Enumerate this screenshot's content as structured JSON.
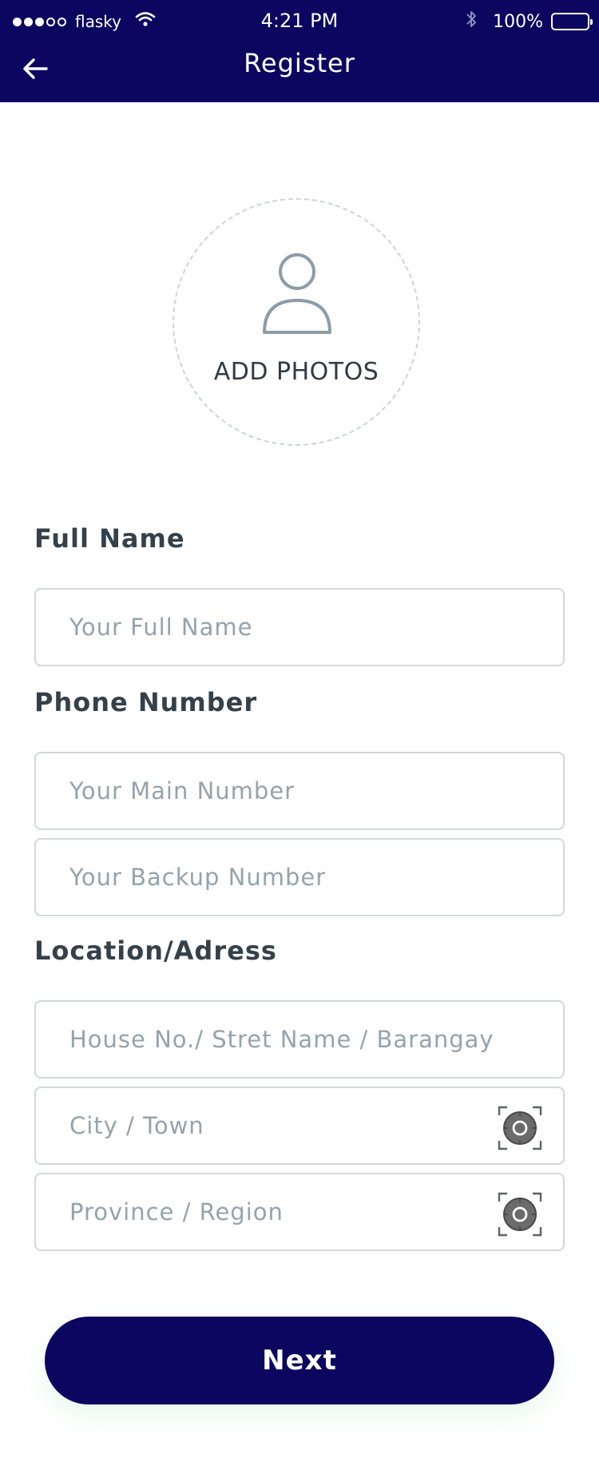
{
  "status_bar": {
    "carrier": "flasky",
    "time": "4:21 PM",
    "battery": "100%"
  },
  "nav": {
    "title": "Register"
  },
  "photo": {
    "label": "ADD PHOTOS"
  },
  "sections": {
    "full_name": "Full Name",
    "phone": "Phone Number",
    "location": "Location/Adress"
  },
  "fields": {
    "full_name_placeholder": "Your Full Name",
    "main_number_placeholder": "Your Main Number",
    "backup_number_placeholder": "Your Backup Number",
    "street_placeholder": "House No./ Stret Name / Barangay",
    "city_placeholder": "City / Town",
    "province_placeholder": "Province / Region"
  },
  "buttons": {
    "next": "Next"
  },
  "colors": {
    "brand": "#0b0760",
    "label": "#35414a",
    "placeholder": "#94a3ad",
    "border": "#d3d7da"
  }
}
